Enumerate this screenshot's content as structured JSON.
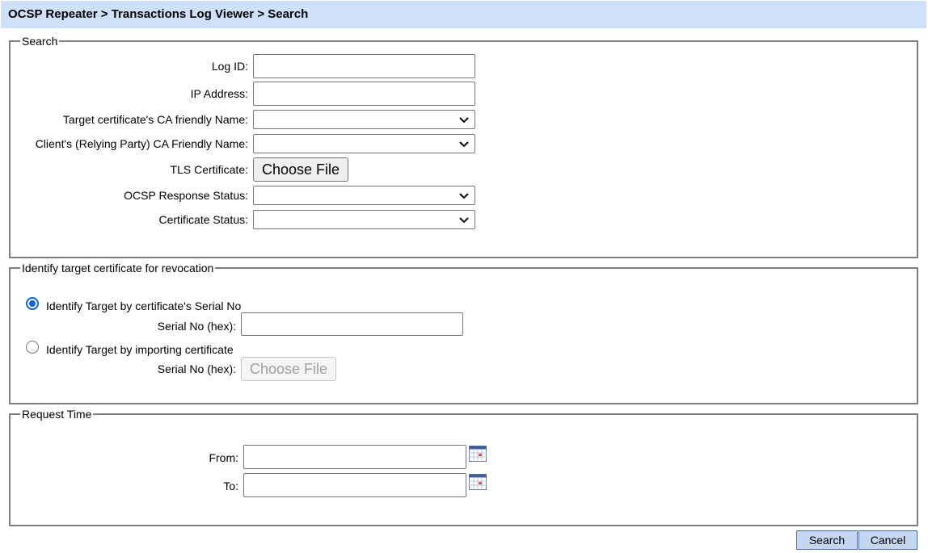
{
  "header": {
    "breadcrumb": "OCSP Repeater > Transactions Log Viewer > Search"
  },
  "search_panel": {
    "legend": "Search",
    "log_id_label": "Log ID:",
    "log_id_value": "",
    "ip_label": "IP Address:",
    "ip_value": "",
    "target_ca_label": "Target certificate's CA friendly Name:",
    "target_ca_value": "",
    "client_ca_label": "Client's (Relying Party) CA Friendly Name:",
    "client_ca_value": "",
    "tls_label": "TLS Certificate:",
    "tls_button": "Choose File",
    "ocsp_status_label": "OCSP Response Status:",
    "ocsp_status_value": "",
    "cert_status_label": "Certificate Status:",
    "cert_status_value": ""
  },
  "revocation_panel": {
    "legend": "Identify target certificate for revocation",
    "option_serial": "Identify Target by certificate's Serial No",
    "serial_label": "Serial No (hex):",
    "serial_value": "",
    "option_import": "Identify Target by importing certificate",
    "import_label": "Serial No (hex):",
    "import_button": "Choose File",
    "selected_option": "serial"
  },
  "time_panel": {
    "legend": "Request Time",
    "from_label": "From:",
    "from_value": "",
    "to_label": "To:",
    "to_value": ""
  },
  "actions": {
    "search": "Search",
    "cancel": "Cancel"
  },
  "icons": {
    "dropdown": "chevron-down-icon",
    "calendar": "calendar-icon"
  },
  "colors": {
    "header_bg": "#cfe0fb",
    "button_bg": "#c4d6f1",
    "radio_accent": "#0b63e8"
  }
}
